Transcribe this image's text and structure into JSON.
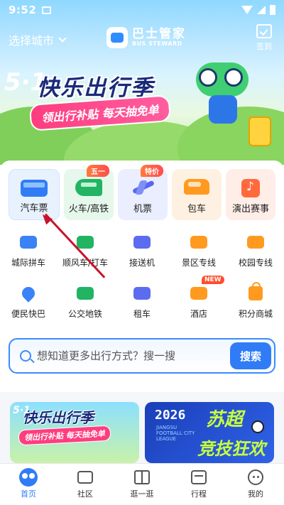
{
  "status_bar": {
    "time": "9:52"
  },
  "header": {
    "city_label": "选择城市",
    "logo_cn": "巴士管家",
    "logo_en": "BUS STEWARD",
    "checkin_label": "签到"
  },
  "banner": {
    "prefix": "5·1",
    "title": "快乐出行季",
    "subtitle": "领出行补贴 每天抽免单"
  },
  "main_services": [
    {
      "label": "汽车票",
      "icon": "bus-icon",
      "badge": ""
    },
    {
      "label": "火车/高铁",
      "icon": "train-icon",
      "badge": "五一"
    },
    {
      "label": "机票",
      "icon": "plane-icon",
      "badge": "特价"
    },
    {
      "label": "包车",
      "icon": "car-icon",
      "badge": ""
    },
    {
      "label": "演出赛事",
      "icon": "music-icon",
      "badge": ""
    }
  ],
  "sub_services": [
    {
      "label": "城际拼车",
      "icon": "car-icon"
    },
    {
      "label": "顺风车/打车",
      "icon": "taxi-icon"
    },
    {
      "label": "接送机",
      "icon": "airport-shuttle-icon"
    },
    {
      "label": "景区专线",
      "icon": "scenic-gate-icon"
    },
    {
      "label": "校园专线",
      "icon": "campus-bus-icon"
    },
    {
      "label": "便民快巴",
      "icon": "location-pin-icon"
    },
    {
      "label": "公交地铁",
      "icon": "metro-icon"
    },
    {
      "label": "租车",
      "icon": "rental-car-icon"
    },
    {
      "label": "酒店",
      "icon": "hotel-icon",
      "badge": "NEW"
    },
    {
      "label": "积分商城",
      "icon": "shopping-bag-icon"
    }
  ],
  "search": {
    "placeholder": "想知道更多出行方式？搜一搜",
    "button_label": "搜索"
  },
  "promos": {
    "left": {
      "prefix": "5·1",
      "title": "快乐出行季",
      "subtitle": "领出行补贴 每天抽免单"
    },
    "right": {
      "year": "2026",
      "league": "JIANGSU FOOTBALL CITY LEAGUE",
      "title_top": "苏超",
      "title_bottom": "竞技狂欢"
    }
  },
  "tabs": [
    {
      "label": "首页",
      "icon": "home-icon",
      "active": true
    },
    {
      "label": "社区",
      "icon": "community-icon",
      "active": false
    },
    {
      "label": "逛一逛",
      "icon": "gift-icon",
      "active": false
    },
    {
      "label": "行程",
      "icon": "itinerary-icon",
      "active": false
    },
    {
      "label": "我的",
      "icon": "profile-icon",
      "active": false
    }
  ],
  "colors": {
    "accent": "#2f7cf6",
    "annotation": "#c8142b"
  }
}
